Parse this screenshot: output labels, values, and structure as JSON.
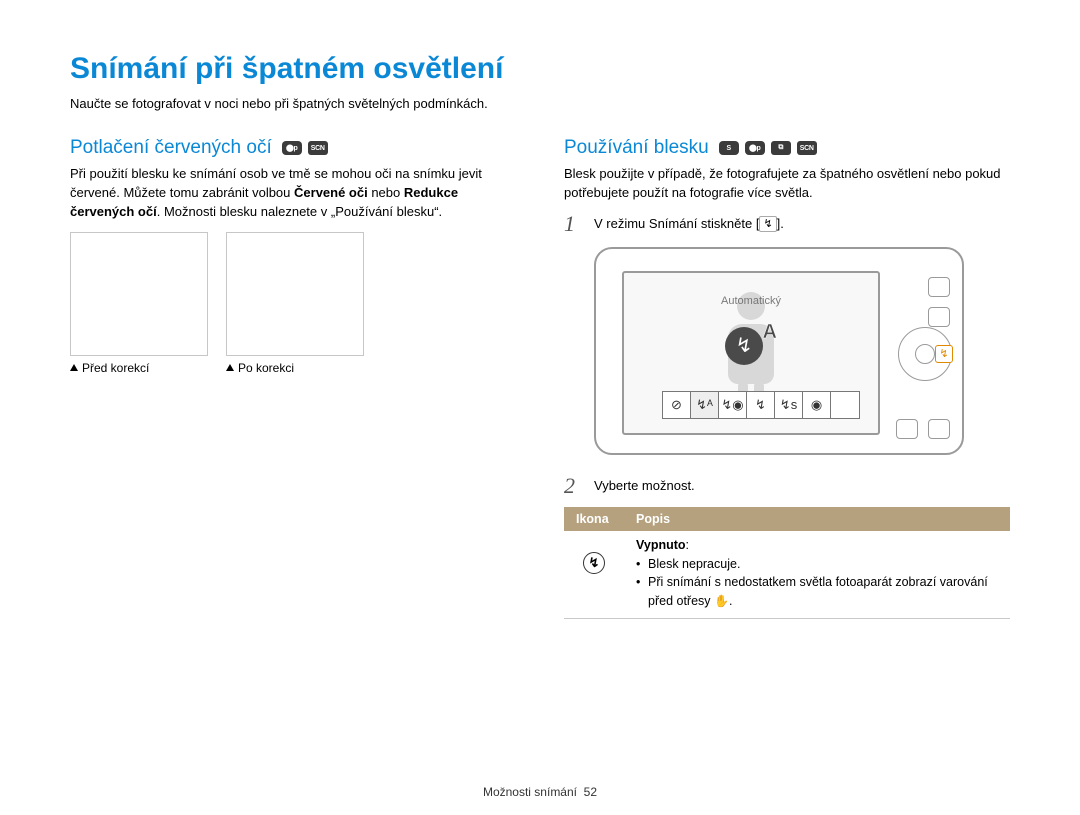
{
  "title": "Snímání při špatném osvětlení",
  "subtitle": "Naučte se fotografovat v noci nebo při špatných světelných podmínkách.",
  "left": {
    "heading": "Potlačení červených očí",
    "modes": [
      "p",
      "s"
    ],
    "para_pre": "Při použití blesku ke snímání osob ve tmě se mohou oči na snímku jevit červené. Můžete tomu zabránit volbou ",
    "b1": "Červené oči",
    "mid": " nebo ",
    "b2": "Redukce červených očí",
    "para_post": ". Možnosti blesku naleznete v „Používání blesku“.",
    "caption1": "Před korekcí",
    "caption2": "Po korekci"
  },
  "right": {
    "heading": "Používání blesku",
    "modes": [
      "S",
      "p",
      "d",
      "s"
    ],
    "intro": "Blesk použijte v případě, že fotografujete za špatného osvětlení nebo pokud potřebujete použít na fotografie více světla.",
    "step1_pre": "V režimu Snímání stiskněte [",
    "step1_icon": "↯",
    "step1_post": "].",
    "step2": "Vyberte možnost.",
    "auto_label": "Automatický",
    "flash_a": "A",
    "th_icon": "Ikona",
    "th_desc": "Popis",
    "row_title": "Vypnuto",
    "row_colon": ":",
    "row_li1": "Blesk nepracuje.",
    "row_li2_pre": "Při snímání s nedostatkem světla fotoaparát zobrazí varování před otřesy ",
    "row_li2_post": "."
  },
  "footer_label": "Možnosti snímání",
  "footer_page": "52"
}
